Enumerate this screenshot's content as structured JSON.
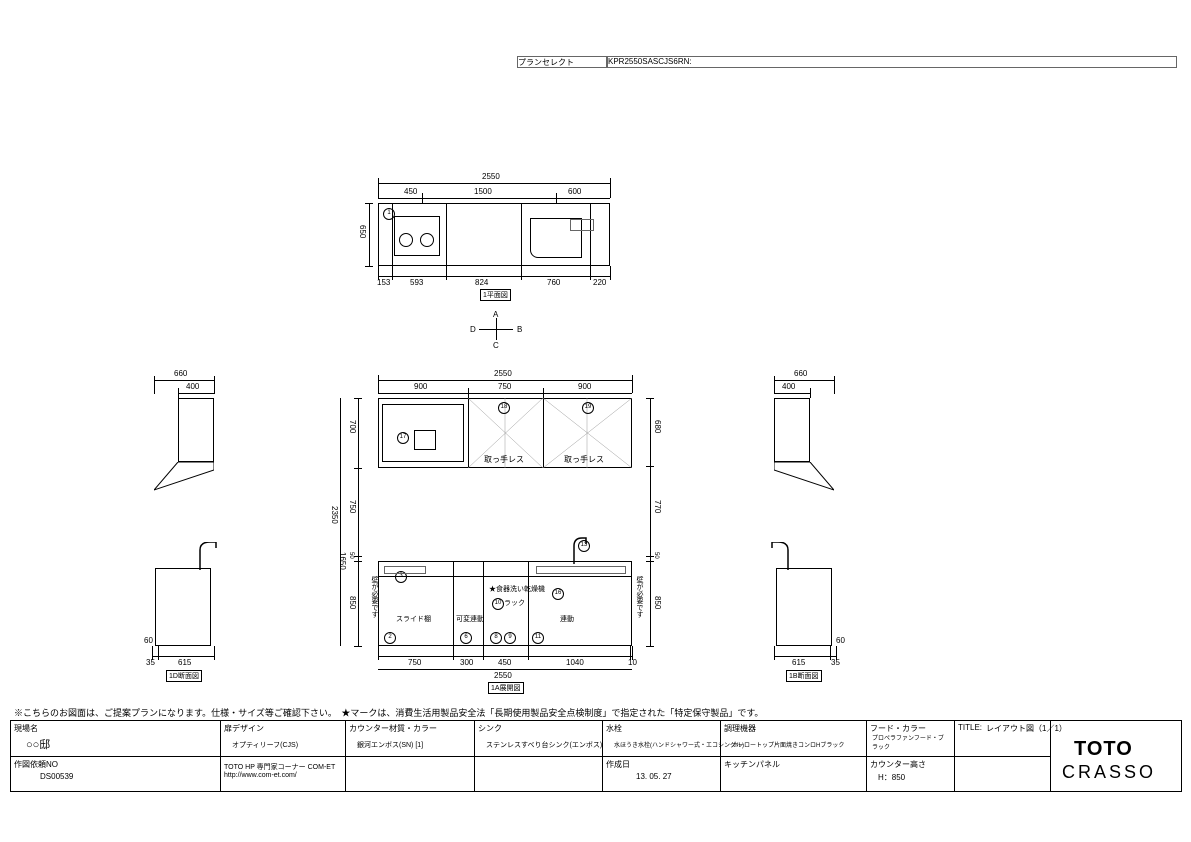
{
  "header": {
    "left": "プランセレクト",
    "right": "KPR2550SASCJS6RN:"
  },
  "top": {
    "total": "2550",
    "up": {
      "a": "450",
      "b": "1500",
      "c": "600"
    },
    "down": {
      "a": "153",
      "b": "593",
      "c": "824",
      "d": "760",
      "e": "220"
    },
    "h": "650",
    "label": "1平面図"
  },
  "compass": {
    "a": "A",
    "b": "B",
    "c": "C",
    "d": "D"
  },
  "side": {
    "left": {
      "top": "660",
      "sub": "400",
      "bot_a": "35",
      "bot_b": "615",
      "label": "1D断面図",
      "under": "60"
    },
    "right": {
      "top": "660",
      "sub": "400",
      "bot_a": "615",
      "bot_b": "35",
      "label": "1B断面図",
      "under": "60"
    }
  },
  "front": {
    "total_top": "2550",
    "up": {
      "a": "900",
      "b": "750",
      "c": "900"
    },
    "h700": "700",
    "h750": "750",
    "h50": "50",
    "h850": "850",
    "h2350": "2350",
    "h1650": "1650",
    "r680": "680",
    "r770": "770",
    "r50": "50",
    "r850": "850",
    "wall_note": "壁が必要です",
    "handleless": "取っ手レス",
    "dw": "★食器洗い乾燥機",
    "rack": "ラック",
    "slide": "スライド棚",
    "kahen": "可変連動",
    "rendo": "連動",
    "bot": {
      "a": "750",
      "b": "300",
      "c": "450",
      "d": "1040",
      "e": "10"
    },
    "total_bot": "2550",
    "label": "1A展開図",
    "ids": {
      "c1": "1",
      "c2": "2",
      "c3": "3",
      "c6": "6",
      "c8": "8",
      "c9": "9",
      "c10": "10",
      "c11": "11",
      "c13": "13",
      "c16": "16",
      "c17": "17",
      "c18": "18",
      "c19": "19"
    }
  },
  "note": "※こちらのお図面は、ご提案プランになります。仕様・サイズ等ご確認下さい。　★マークは、消費生活用製品安全法「長期使用製品安全点検制度」で指定された「特定保守製品」です。",
  "table": {
    "r1": {
      "c1h": "現場名",
      "c1v": "○○邸",
      "c2h": "扉デザイン",
      "c2v": "オプティリーフ(CJS)",
      "c3h": "カウンター材質・カラー",
      "c3v": "銀河エンボス(SN) [1]",
      "c4h": "シンク",
      "c4v": "ステンレスすべり台シンク(エンボス)",
      "c5h": "水栓",
      "c5v": "水ほうき水栓(ハンドシャワー式・エコシングル)",
      "c6h": "調理機器",
      "c6v": "ホーロートップ片面焼きコンロHブラック",
      "c7h": "フード・カラー",
      "c7v": "プロペラファンフード・ブラック"
    },
    "r2": {
      "c1h": "作図依頼NO",
      "c1v": "DS00539",
      "c2h": "",
      "c2v": "TOTO HP 専門家コーナー COM-ET\nhttp://www.com-et.com/",
      "c3h": "",
      "c3v": "",
      "c4h": "",
      "c4v": "",
      "c5h": "作成日",
      "c5v": "13. 05. 27",
      "c6h": "キッチンパネル",
      "c6v": "",
      "c7h": "カウンター高さ",
      "c7v": "H：850"
    },
    "title_h": "TITLE:",
    "title_v": "レイアウト図（1／1）",
    "brand1": "TOTO",
    "brand2": "CRASSO"
  }
}
